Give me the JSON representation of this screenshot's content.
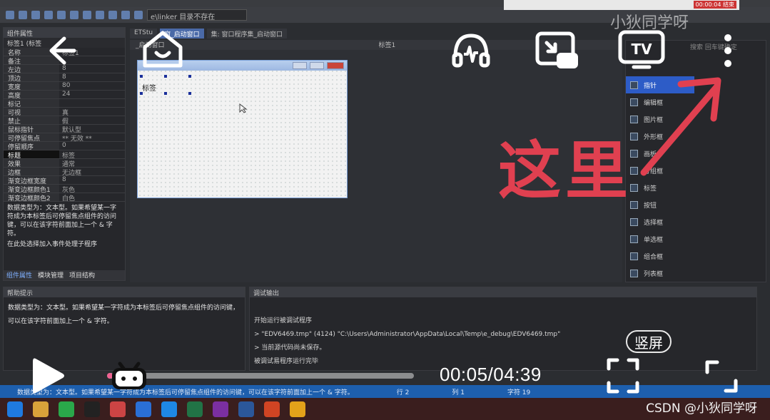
{
  "ide": {
    "toolbar_combo": "e\\linker 目录不存在",
    "record_time": "00:00:04 结束",
    "watermark": "小狄同学呀",
    "props_title": "组件属性",
    "props_selected": "标签1 (标签",
    "properties": [
      {
        "k": "名称",
        "v": "标签1"
      },
      {
        "k": "备注",
        "v": ""
      },
      {
        "k": "左边",
        "v": "8"
      },
      {
        "k": "顶边",
        "v": "8"
      },
      {
        "k": "宽度",
        "v": "80"
      },
      {
        "k": "高度",
        "v": "24"
      },
      {
        "k": "标记",
        "v": ""
      },
      {
        "k": "可视",
        "v": "真"
      },
      {
        "k": "禁止",
        "v": "假"
      },
      {
        "k": "鼠标指针",
        "v": "默认型"
      },
      {
        "k": "可停留焦点",
        "v": "** 无效 **"
      },
      {
        "k": "停留顺序",
        "v": "0"
      },
      {
        "k": "标题",
        "v": "标签",
        "selected": true
      },
      {
        "k": "效果",
        "v": "通常"
      },
      {
        "k": "边框",
        "v": "无边框"
      },
      {
        "k": "渐变边框宽度",
        "v": "8"
      },
      {
        "k": "渐变边框颜色1",
        "v": "灰色"
      },
      {
        "k": "渐变边框颜色2",
        "v": "白色"
      }
    ],
    "prop_description": "数据类型为：文本型。如果希望某一字符成为本标签后可停留焦点组件的访问键，可以在该字符前面加上一个 & 字符。",
    "event_hint": "在此处选择加入事件处理子程序",
    "prop_tabs": [
      "组件属性",
      "模块管理",
      "项目结构"
    ],
    "doc_tabs": [
      {
        "label": "ETStu",
        "active": false
      },
      {
        "label": "窗_启动窗口",
        "active": true
      },
      {
        "label": "集: 窗口程序集_启动窗口",
        "active": false
      }
    ],
    "design_combo_left": "_启动窗口",
    "design_combo_right": "标签1",
    "form_label": "标签",
    "toolbox_search": "搜索 回车键确定",
    "toolbox": [
      {
        "label": "指针",
        "selected": true
      },
      {
        "label": "编辑框"
      },
      {
        "label": "图片框"
      },
      {
        "label": "外形框"
      },
      {
        "label": "画板"
      },
      {
        "label": "分组框"
      },
      {
        "label": "标签"
      },
      {
        "label": "按钮"
      },
      {
        "label": "选择框"
      },
      {
        "label": "单选框"
      },
      {
        "label": "组合框"
      },
      {
        "label": "列表框"
      }
    ],
    "help_title": "帮助提示",
    "help_text": "数据类型为：文本型。如果希望某一字符成为本标签后可停留焦点组件的访问键，可以在该字符前面加上一个 & 字符。",
    "debug_title": "调试输出",
    "debug_lines": [
      "开始运行被调试程序",
      "> \"EDV6469.tmp\" (4124) \"C:\\Users\\Administrator\\AppData\\Local\\Temp\\e_debug\\EDV6469.tmp\"",
      "> 当前源代码尚未保存。",
      "被调试易程序运行完毕"
    ],
    "status_text": "数据类型为：文本型。如果希望某一字符成为本标签后可停留焦点组件的访问键，可以在该字符前面加上一个 & 字符。",
    "status_row": "行 2",
    "status_col": "列 1",
    "status_char": "字符 19"
  },
  "player": {
    "annotation": "这里",
    "vertical_label": "竖屏",
    "time": "00:05/04:39",
    "progress_fraction": 0.018,
    "accent_color": "#f06292",
    "annotation_color": "#e04050",
    "icons": [
      "back-arrow-icon",
      "home-icon",
      "audio-headphones-icon",
      "picture-in-picture-icon",
      "tv-cast-icon",
      "more-vertical-icon",
      "play-icon",
      "fullscreen-icon",
      "expand-icon"
    ]
  },
  "watermark_bottom": "CSDN @小狄同学呀"
}
